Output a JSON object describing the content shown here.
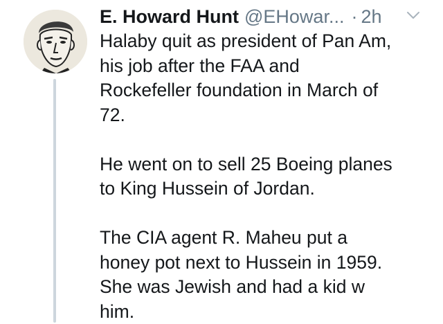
{
  "tweet": {
    "display_name": "E. Howard Hunt",
    "handle": "@EHowar...",
    "separator": "·",
    "timestamp": "2h",
    "menu_icon": "chevron-down-icon",
    "avatar_icon": "portrait-sketch-icon",
    "paragraphs": [
      [
        "Halaby quit as president of Pan Am,",
        "his job after the FAA and",
        "Rockefeller foundation in March of",
        "72."
      ],
      [
        "He went on to sell 25 Boeing planes",
        "to King Hussein of Jordan."
      ],
      [
        "The CIA agent R. Maheu put a",
        "honey pot next to Hussein in 1959.",
        "She was Jewish and had a kid w",
        "him."
      ]
    ]
  },
  "colors": {
    "text": "#14171a",
    "secondary": "#657786",
    "thread_line": "#cdd6dd",
    "background": "#ffffff"
  }
}
